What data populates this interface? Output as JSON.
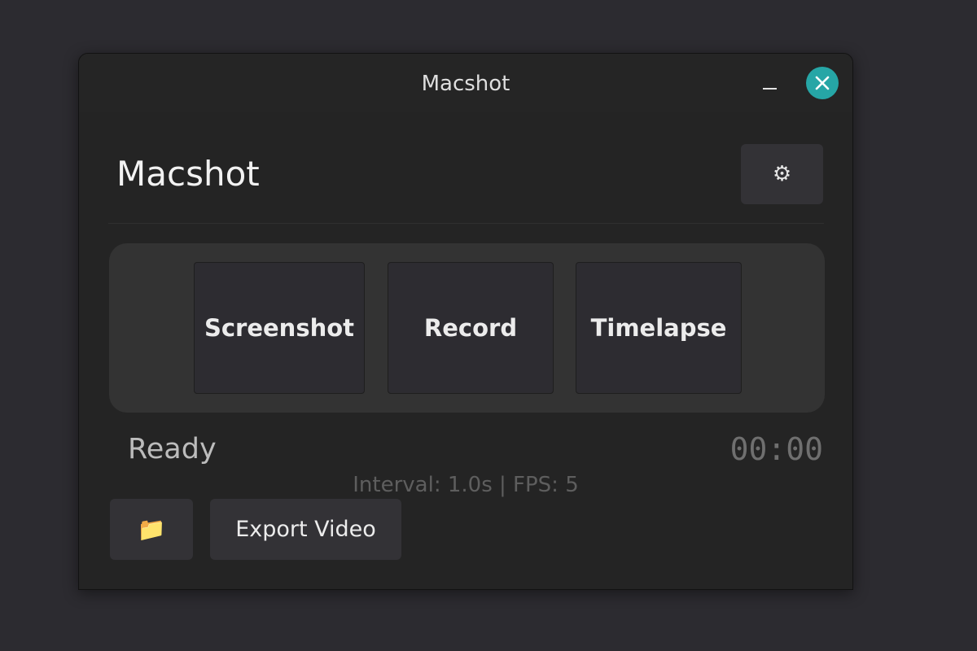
{
  "window": {
    "title": "Macshot"
  },
  "header": {
    "app_title": "Macshot",
    "settings_icon": "gear-icon",
    "settings_glyph": "⚙"
  },
  "modes": [
    {
      "label": "Screenshot"
    },
    {
      "label": "Record"
    },
    {
      "label": "Timelapse"
    }
  ],
  "status": {
    "text": "Ready",
    "timer": "00:00",
    "info": "Interval: 1.0s | FPS: 5"
  },
  "actions": {
    "folder_icon": "folder-icon",
    "folder_glyph": "📁",
    "export_label": "Export Video"
  },
  "colors": {
    "background": "#2c2b30",
    "window": "#242424",
    "close_button": "#26a6a6",
    "button": "#333236"
  }
}
